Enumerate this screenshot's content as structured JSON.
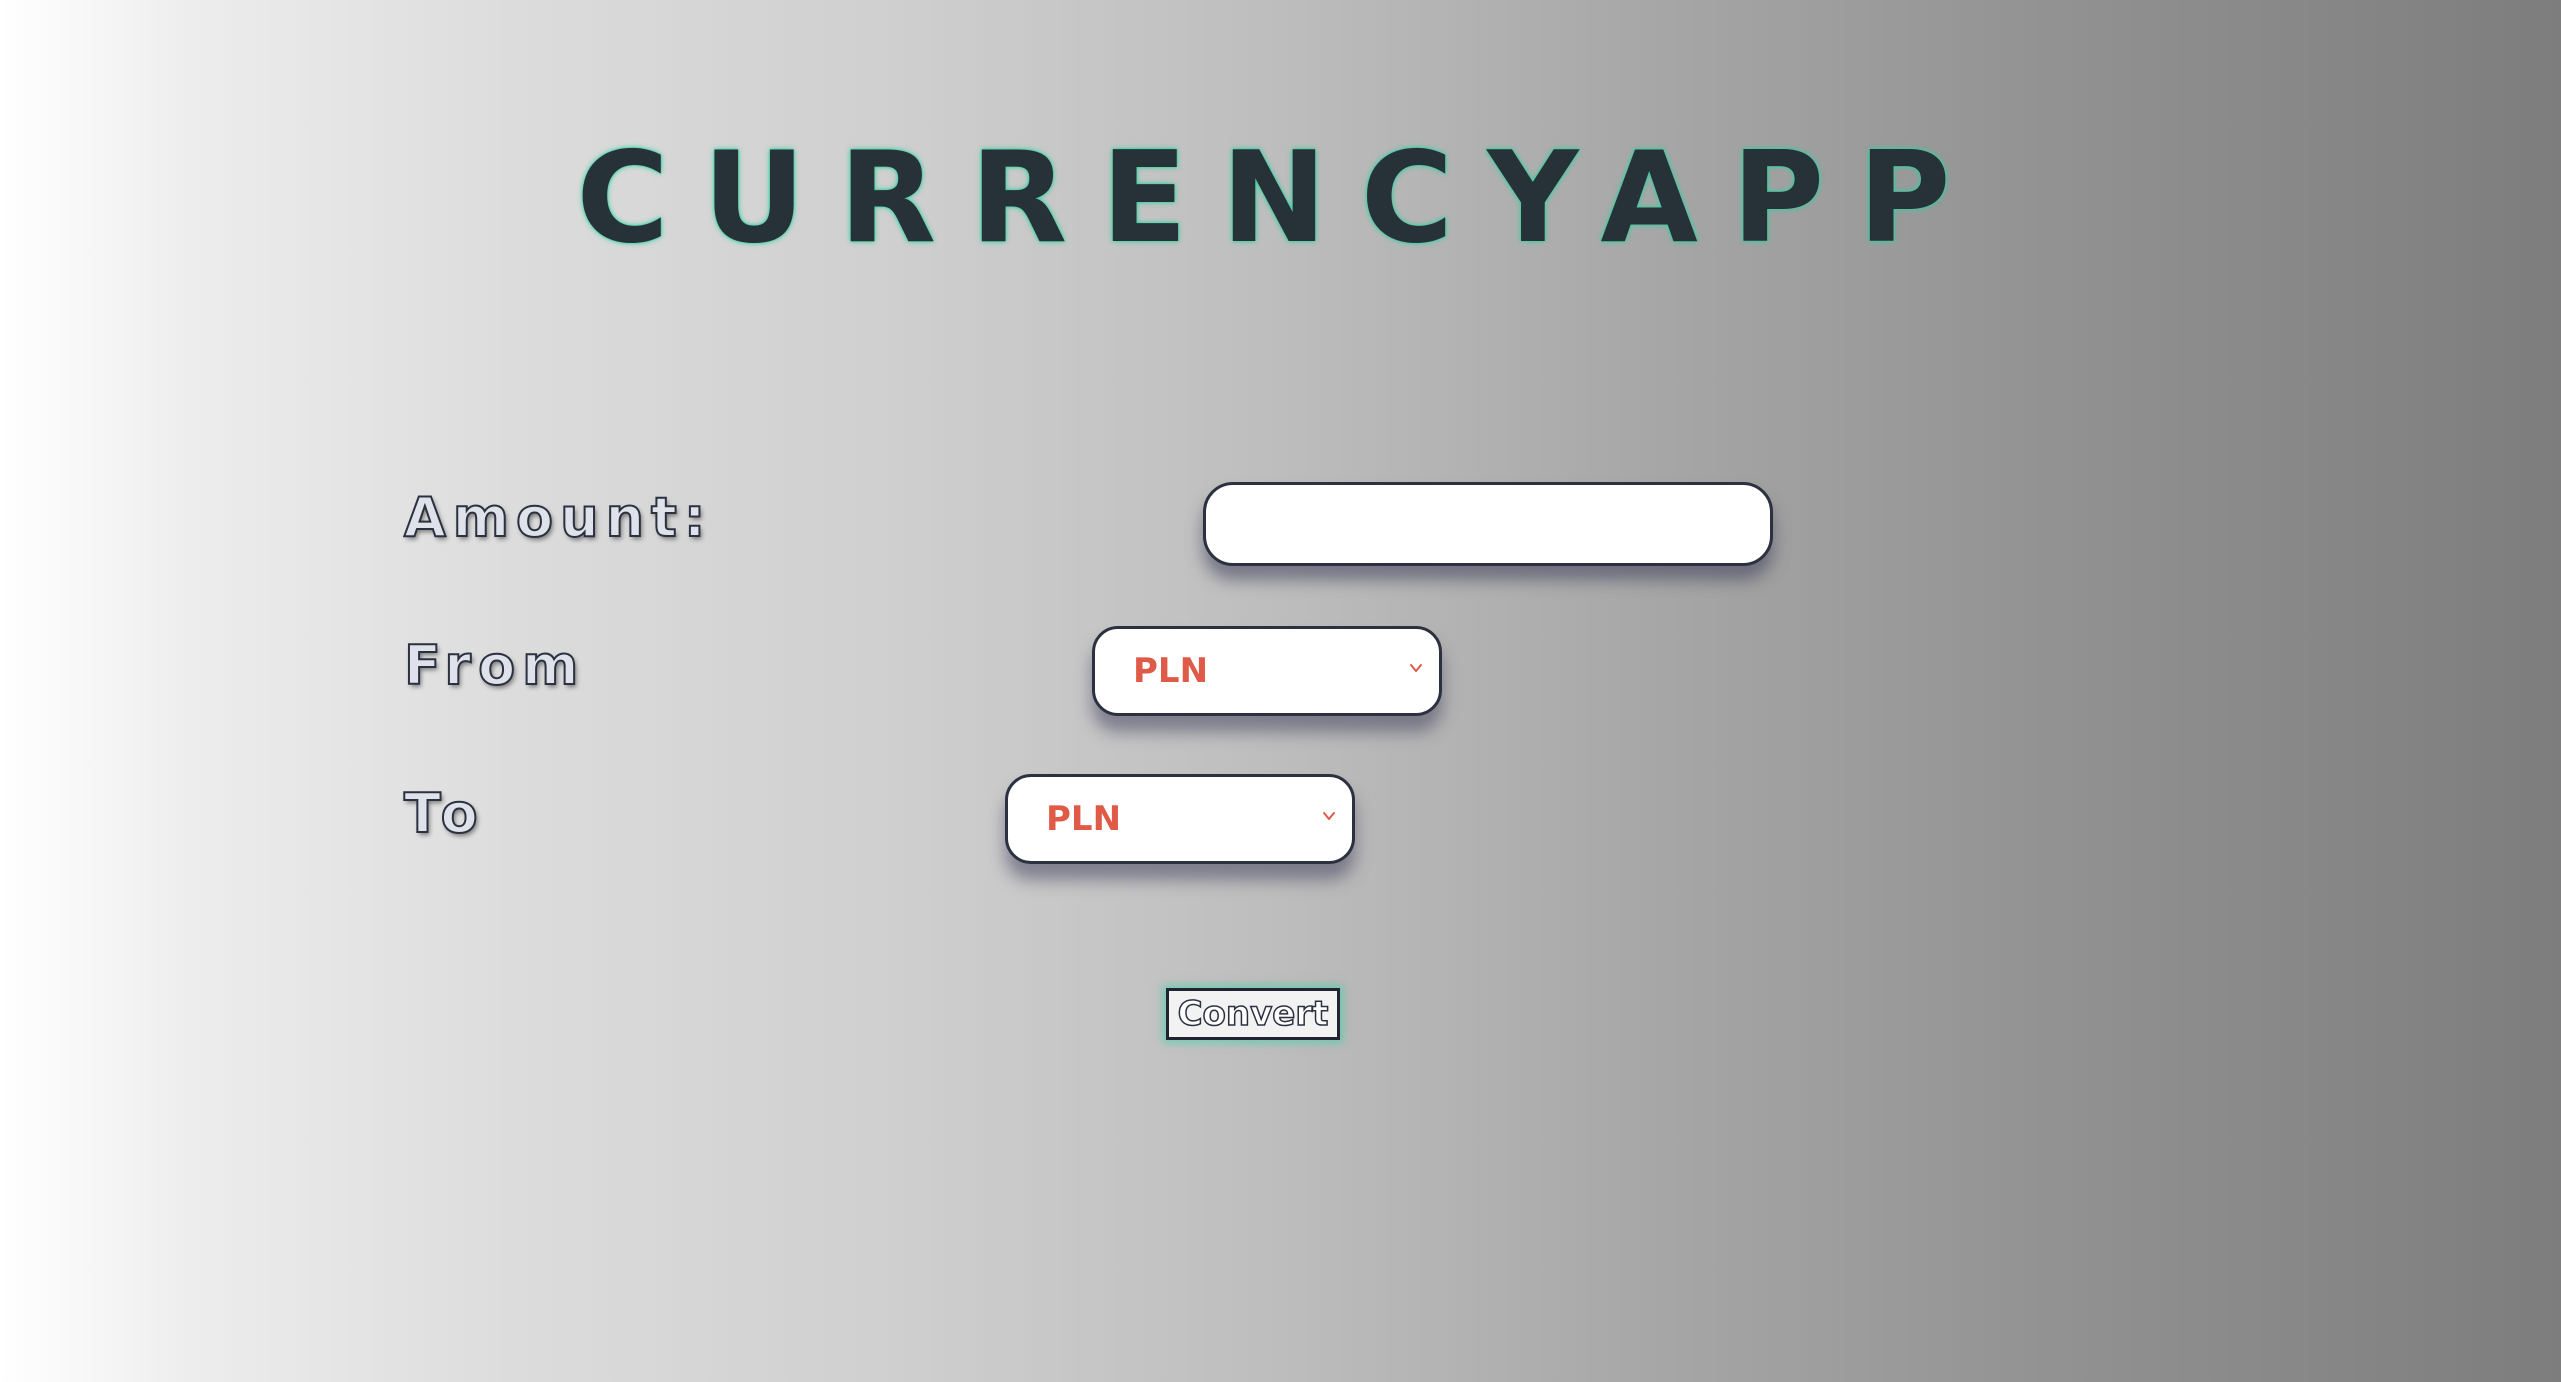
{
  "app": {
    "title": "CURRENCYAPP"
  },
  "form": {
    "amount_label": "Amount:",
    "amount_value": "",
    "from_label": "From",
    "from_value": "PLN",
    "to_label": "To",
    "to_value": "PLN",
    "convert_label": "Convert"
  },
  "colors": {
    "title_text": "#263238",
    "title_glow": "#2fd1a0",
    "select_text": "#e05a48",
    "border": "#2c3140"
  },
  "icons": {
    "dropdown": "chevron-down-icon"
  }
}
